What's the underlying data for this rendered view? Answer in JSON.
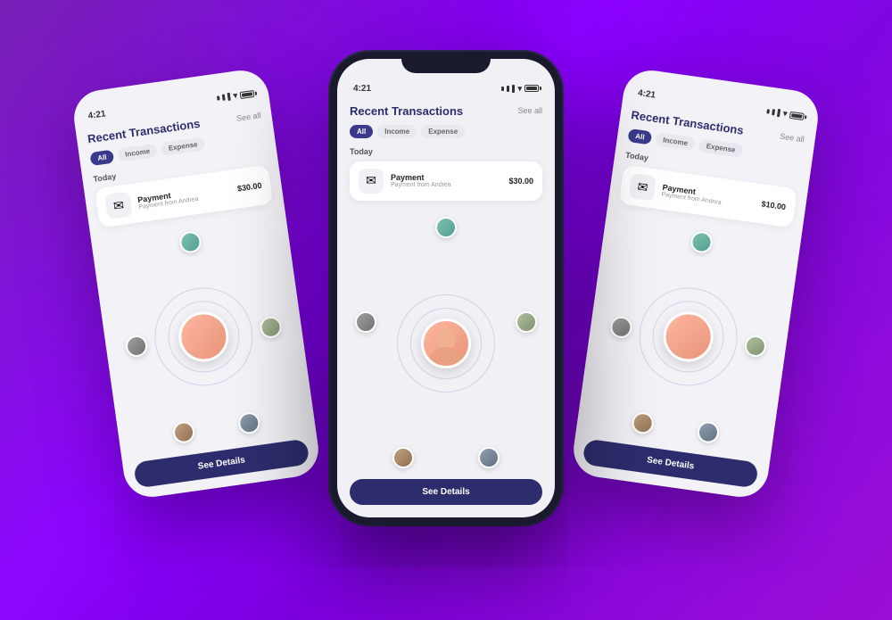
{
  "background": {
    "gradient_start": "#6a0dad",
    "gradient_end": "#9400d3"
  },
  "app": {
    "title": "Recent Transactions",
    "see_all": "See all",
    "status_time": "4:21",
    "filters": [
      "All",
      "Income",
      "Expense"
    ],
    "active_filter": "All",
    "day_label": "Today",
    "transaction": {
      "name": "Payment",
      "subtitle": "Payment from Andrea",
      "amount": "$30.00"
    },
    "see_details_label": "See Details"
  },
  "left_card": {
    "title": "Recent Transactions",
    "see_all": "See all",
    "status_time": "4:21",
    "day_label": "Today",
    "transaction_name": "Payment",
    "transaction_sub": "Payment from Andrea",
    "transaction_amount": "$30.00",
    "see_details": "See Details"
  },
  "right_card": {
    "title": "Recent Transactions",
    "see_all": "See all",
    "status_time": "4:21",
    "day_label": "Today",
    "transaction_name": "Payment",
    "transaction_sub": "Payment from Andrea",
    "transaction_amount": "$10.00",
    "see_details": "See Details"
  }
}
